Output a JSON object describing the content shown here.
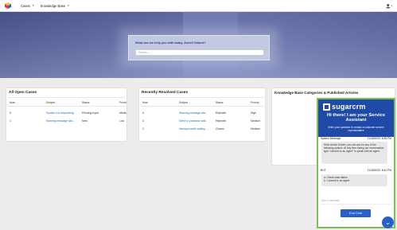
{
  "nav": {
    "logo_icon": "sugar-cube-icon",
    "items": [
      {
        "label": "Cases"
      },
      {
        "label": "Knowledge Base"
      }
    ],
    "user_icon": "user-icon"
  },
  "hero": {
    "prompt": "What can we help you with today, Anneli Gobert?",
    "search_placeholder": "Search..."
  },
  "open_cases": {
    "title": "All Open Cases",
    "headers": [
      "Num",
      "Subject",
      "Status",
      "Priority"
    ],
    "rows": [
      {
        "num": "5",
        "subject": "System not responding",
        "status": "Pending Input",
        "priority": "Medium"
      },
      {
        "num": "1",
        "subject": "Warning message alw...",
        "status": "New",
        "priority": "Low"
      }
    ]
  },
  "resolved_cases": {
    "title": "Recently Resolved Cases",
    "headers": [
      "Num",
      "Subject",
      "Status",
      "Priority"
    ],
    "rows": [
      {
        "num": "4",
        "subject": "Warning message alw...",
        "status": "Rejected",
        "priority": "High"
      },
      {
        "num": "3",
        "subject": "Need to purchase add...",
        "status": "Rejected",
        "priority": "Medium"
      },
      {
        "num": "2",
        "subject": "Having trouble adding ...",
        "status": "Closed",
        "priority": "Medium"
      }
    ]
  },
  "kb": {
    "title": "Knowledge Base Categories & Published Articles"
  },
  "chat": {
    "brand": "sugarcrm",
    "greeting": "Hi there! I am your Service Assistant",
    "subtitle": "Enter your question to contact a customer service representative",
    "partial_head": "System Message",
    "partial_time": "11/18/2020, 8:38 PM",
    "bubble1": "Hello Anneli Gobert, you can ask for any of the following options. At any time during our conversation, type \"connect to an agent\" to speak with an agent.",
    "bot_name": "BOT",
    "bot_time": "11/18/2020, 8:42 PM",
    "bubble2_line1": "a. Check case status",
    "bubble2_line2": "b. Connect to an agent",
    "input_placeholder": "Type a message",
    "end_button": "End Chat",
    "toggle_icon": "chevron-down-icon"
  },
  "colors": {
    "accent": "#2760c9",
    "chat_border": "#7cc04e",
    "link": "#2a6cc4"
  }
}
